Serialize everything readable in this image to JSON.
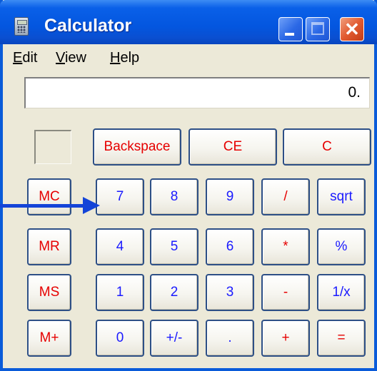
{
  "window": {
    "title": "Calculator"
  },
  "menu": {
    "items": [
      {
        "underline": "E",
        "rest": "dit"
      },
      {
        "underline": "V",
        "rest": "iew"
      },
      {
        "underline": "H",
        "rest": "elp"
      }
    ]
  },
  "display": {
    "value": "0."
  },
  "keys": {
    "backspace": "Backspace",
    "ce": "CE",
    "c": "C",
    "mc": "MC",
    "mr": "MR",
    "ms": "MS",
    "mplus": "M+",
    "n7": "7",
    "n8": "8",
    "n9": "9",
    "div": "/",
    "sqrt": "sqrt",
    "n4": "4",
    "n5": "5",
    "n6": "6",
    "mul": "*",
    "pct": "%",
    "n1": "1",
    "n2": "2",
    "n3": "3",
    "sub": "-",
    "inv": "1/x",
    "n0": "0",
    "neg": "+/-",
    "dot": ".",
    "add": "+",
    "eq": "="
  },
  "colors": {
    "title_bar": "#0356df",
    "operator_text": "#e60000",
    "digit_text": "#1a1aff",
    "annotation_arrow": "#1444d8"
  },
  "icons": {
    "app": "calculator-icon",
    "minimize": "minimize-icon",
    "maximize": "maximize-icon",
    "close": "close-icon",
    "annotation": "arrow-right-icon"
  }
}
